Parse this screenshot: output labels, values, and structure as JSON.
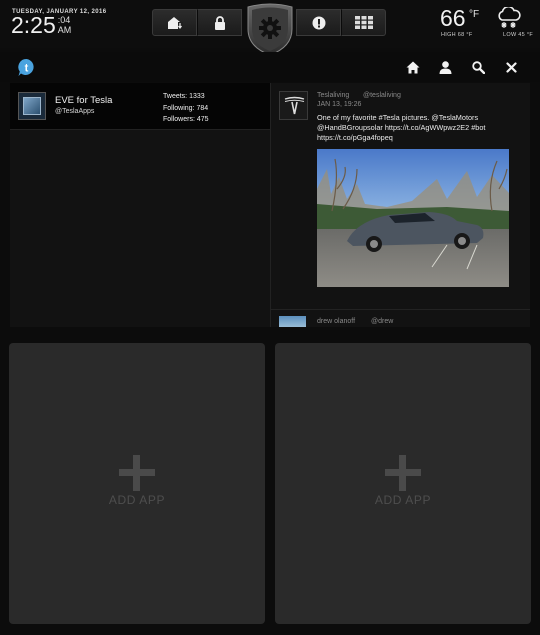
{
  "status": {
    "date": "TUESDAY, JANUARY 12, 2016",
    "time": "2:25",
    "seconds": ":04",
    "ampm": "AM"
  },
  "nav": {
    "left_icons": [
      "garage-icon",
      "lock-icon"
    ],
    "center_icon": "gear-icon",
    "right_icons": [
      "alert-icon",
      "grid-icon"
    ]
  },
  "weather": {
    "temp": "66",
    "unit": "°F",
    "high": "HIGH 68 °F",
    "low": "LOW 45 °F",
    "icon": "snow-cloud-icon"
  },
  "appbar": {
    "logo_icon": "twitter-t-icon",
    "actions": [
      "home-icon",
      "profile-icon",
      "search-icon",
      "close-icon"
    ]
  },
  "profile": {
    "name": "EVE for Tesla",
    "handle": "@TeslaApps",
    "tweets": "Tweets: 1333",
    "following": "Following: 784",
    "followers": "Followers: 475"
  },
  "tweet": {
    "name": "Teslaliving",
    "handle": "@teslaliving",
    "date": "JAN 13, 19:26",
    "text": "One of my favorite #Tesla pictures. @TeslaMotors @HandBGroupsolar https://t.co/AgWWpwz2E2 #bot https://t.co/pGga4fopeq"
  },
  "tweet2": {
    "name": "drew olanoff",
    "handle": "@drew"
  },
  "tiles": {
    "left_label": "ADD APP",
    "right_label": "ADD APP"
  }
}
